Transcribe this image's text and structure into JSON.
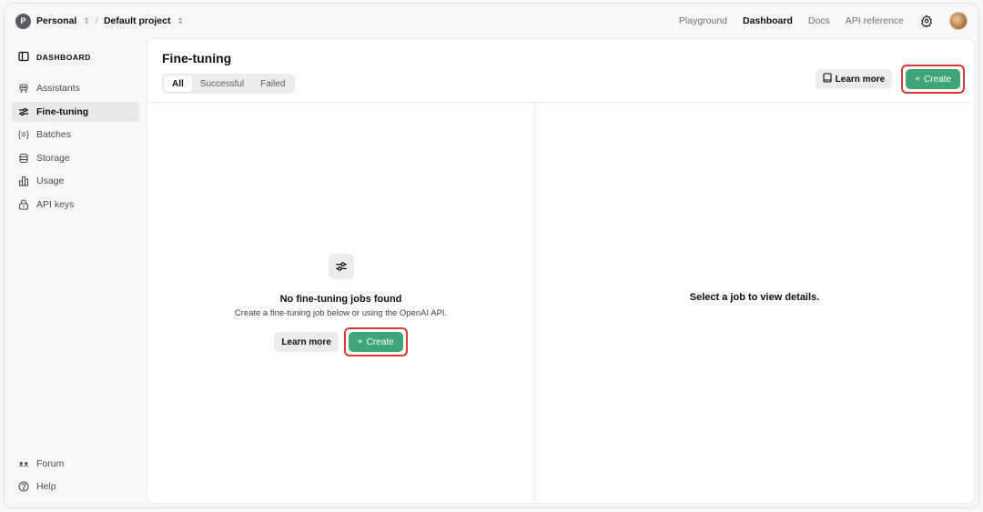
{
  "topbar": {
    "org_initial": "P",
    "org_name": "Personal",
    "separator": "/",
    "project_name": "Default project",
    "nav": [
      "Playground",
      "Dashboard",
      "Docs",
      "API reference"
    ],
    "active_nav": "Dashboard"
  },
  "sidebar": {
    "heading": "DASHBOARD",
    "items": [
      {
        "label": "Assistants",
        "icon": "robot-icon"
      },
      {
        "label": "Fine-tuning",
        "icon": "sliders-icon",
        "active": true
      },
      {
        "label": "Batches",
        "icon": "braces-icon"
      },
      {
        "label": "Storage",
        "icon": "database-icon"
      },
      {
        "label": "Usage",
        "icon": "bar-chart-icon"
      },
      {
        "label": "API keys",
        "icon": "lock-icon"
      }
    ],
    "bottom": [
      {
        "label": "Forum",
        "icon": "people-icon"
      },
      {
        "label": "Help",
        "icon": "question-icon"
      }
    ]
  },
  "main": {
    "title": "Fine-tuning",
    "tabs": [
      "All",
      "Successful",
      "Failed"
    ],
    "active_tab": "All",
    "learn_more": "Learn more",
    "create": "Create",
    "empty_title": "No fine-tuning jobs found",
    "empty_subtitle": "Create a fine-tuning job below or using the OpenAI API.",
    "empty_learn_more": "Learn more",
    "empty_create": "Create",
    "detail_placeholder": "Select a job to view details."
  },
  "colors": {
    "accent_green": "#3fa479",
    "highlight_red": "#d93a2f"
  }
}
